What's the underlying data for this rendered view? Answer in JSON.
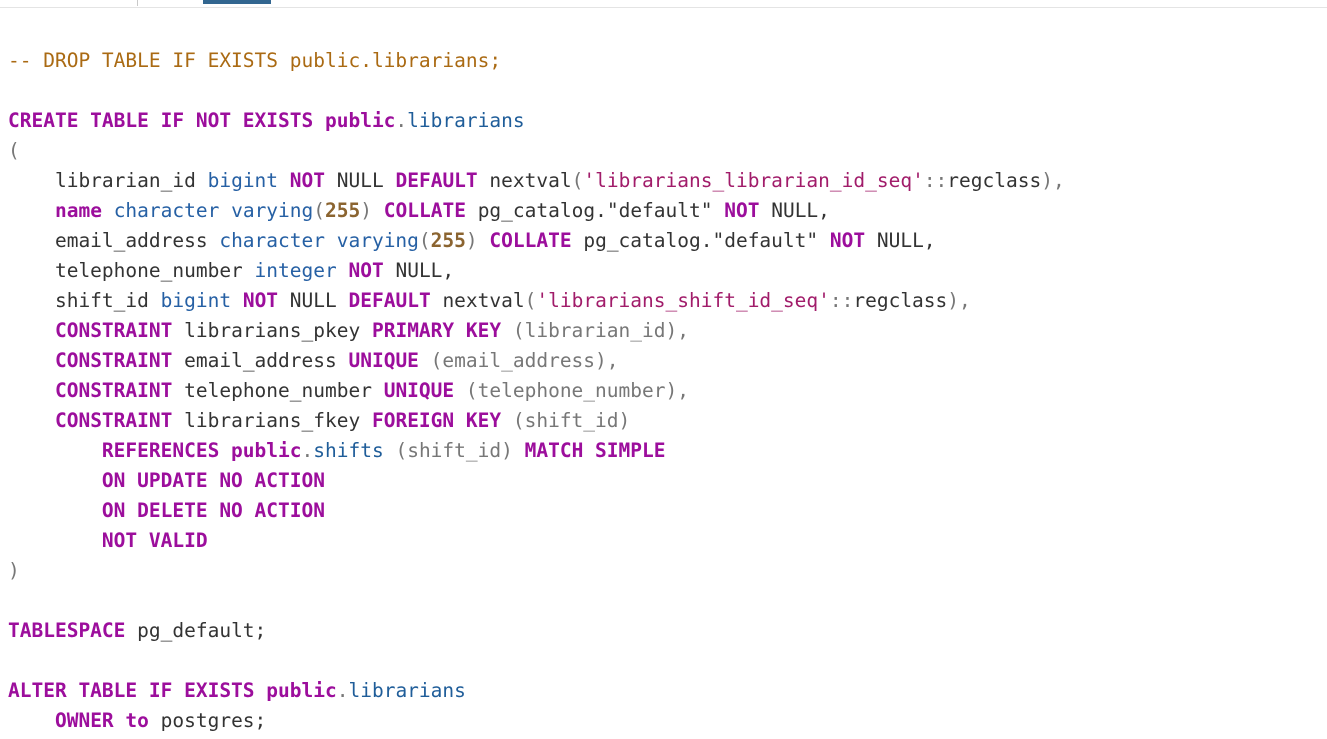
{
  "editor": {
    "lines": [
      [],
      [
        {
          "t": "-- DROP TABLE IF EXISTS public.librarians;",
          "c": "cmt"
        }
      ],
      [],
      [
        {
          "t": "CREATE TABLE IF NOT EXISTS public",
          "c": "kw"
        },
        {
          "t": ".",
          "c": "punc"
        },
        {
          "t": "librarians",
          "c": "ident"
        }
      ],
      [
        {
          "t": "(",
          "c": "punc"
        }
      ],
      [
        {
          "t": "    librarian_id ",
          "c": "plain"
        },
        {
          "t": "bigint",
          "c": "typ"
        },
        {
          "t": " ",
          "c": "plain"
        },
        {
          "t": "NOT",
          "c": "kw"
        },
        {
          "t": " NULL ",
          "c": "plain"
        },
        {
          "t": "DEFAULT",
          "c": "kw"
        },
        {
          "t": " nextval",
          "c": "plain"
        },
        {
          "t": "(",
          "c": "punc"
        },
        {
          "t": "'librarians_librarian_id_seq'",
          "c": "str"
        },
        {
          "t": "::",
          "c": "punc"
        },
        {
          "t": "regclass",
          "c": "plain"
        },
        {
          "t": "),",
          "c": "punc"
        }
      ],
      [
        {
          "t": "    ",
          "c": "plain"
        },
        {
          "t": "name",
          "c": "kw"
        },
        {
          "t": " ",
          "c": "plain"
        },
        {
          "t": "character varying",
          "c": "typ"
        },
        {
          "t": "(",
          "c": "punc"
        },
        {
          "t": "255",
          "c": "num"
        },
        {
          "t": ")",
          "c": "punc"
        },
        {
          "t": " ",
          "c": "plain"
        },
        {
          "t": "COLLATE",
          "c": "kw"
        },
        {
          "t": " pg_catalog.\"default\" ",
          "c": "plain"
        },
        {
          "t": "NOT",
          "c": "kw"
        },
        {
          "t": " NULL,",
          "c": "plain"
        }
      ],
      [
        {
          "t": "    email_address ",
          "c": "plain"
        },
        {
          "t": "character varying",
          "c": "typ"
        },
        {
          "t": "(",
          "c": "punc"
        },
        {
          "t": "255",
          "c": "num"
        },
        {
          "t": ")",
          "c": "punc"
        },
        {
          "t": " ",
          "c": "plain"
        },
        {
          "t": "COLLATE",
          "c": "kw"
        },
        {
          "t": " pg_catalog.\"default\" ",
          "c": "plain"
        },
        {
          "t": "NOT",
          "c": "kw"
        },
        {
          "t": " NULL,",
          "c": "plain"
        }
      ],
      [
        {
          "t": "    telephone_number ",
          "c": "plain"
        },
        {
          "t": "integer",
          "c": "typ"
        },
        {
          "t": " ",
          "c": "plain"
        },
        {
          "t": "NOT",
          "c": "kw"
        },
        {
          "t": " NULL,",
          "c": "plain"
        }
      ],
      [
        {
          "t": "    shift_id ",
          "c": "plain"
        },
        {
          "t": "bigint",
          "c": "typ"
        },
        {
          "t": " ",
          "c": "plain"
        },
        {
          "t": "NOT",
          "c": "kw"
        },
        {
          "t": " NULL ",
          "c": "plain"
        },
        {
          "t": "DEFAULT",
          "c": "kw"
        },
        {
          "t": " nextval",
          "c": "plain"
        },
        {
          "t": "(",
          "c": "punc"
        },
        {
          "t": "'librarians_shift_id_seq'",
          "c": "str"
        },
        {
          "t": "::",
          "c": "punc"
        },
        {
          "t": "regclass",
          "c": "plain"
        },
        {
          "t": "),",
          "c": "punc"
        }
      ],
      [
        {
          "t": "    ",
          "c": "plain"
        },
        {
          "t": "CONSTRAINT",
          "c": "kw"
        },
        {
          "t": " librarians_pkey ",
          "c": "plain"
        },
        {
          "t": "PRIMARY KEY",
          "c": "kw"
        },
        {
          "t": " (librarian_id),",
          "c": "punc"
        }
      ],
      [
        {
          "t": "    ",
          "c": "plain"
        },
        {
          "t": "CONSTRAINT",
          "c": "kw"
        },
        {
          "t": " email_address ",
          "c": "plain"
        },
        {
          "t": "UNIQUE",
          "c": "kw"
        },
        {
          "t": " (email_address),",
          "c": "punc"
        }
      ],
      [
        {
          "t": "    ",
          "c": "plain"
        },
        {
          "t": "CONSTRAINT",
          "c": "kw"
        },
        {
          "t": " telephone_number ",
          "c": "plain"
        },
        {
          "t": "UNIQUE",
          "c": "kw"
        },
        {
          "t": " (telephone_number),",
          "c": "punc"
        }
      ],
      [
        {
          "t": "    ",
          "c": "plain"
        },
        {
          "t": "CONSTRAINT",
          "c": "kw"
        },
        {
          "t": " librarians_fkey ",
          "c": "plain"
        },
        {
          "t": "FOREIGN KEY",
          "c": "kw"
        },
        {
          "t": " (shift_id)",
          "c": "punc"
        }
      ],
      [
        {
          "t": "        ",
          "c": "plain"
        },
        {
          "t": "REFERENCES public",
          "c": "kw"
        },
        {
          "t": ".",
          "c": "punc"
        },
        {
          "t": "shifts",
          "c": "ident"
        },
        {
          "t": " (shift_id) ",
          "c": "punc"
        },
        {
          "t": "MATCH SIMPLE",
          "c": "kw"
        }
      ],
      [
        {
          "t": "        ",
          "c": "plain"
        },
        {
          "t": "ON UPDATE NO ACTION",
          "c": "kw"
        }
      ],
      [
        {
          "t": "        ",
          "c": "plain"
        },
        {
          "t": "ON DELETE NO ACTION",
          "c": "kw"
        }
      ],
      [
        {
          "t": "        ",
          "c": "plain"
        },
        {
          "t": "NOT VALID",
          "c": "kw"
        }
      ],
      [
        {
          "t": ")",
          "c": "punc"
        }
      ],
      [],
      [
        {
          "t": "TABLESPACE",
          "c": "kw"
        },
        {
          "t": " pg_default;",
          "c": "plain"
        }
      ],
      [],
      [
        {
          "t": "ALTER TABLE IF EXISTS public",
          "c": "kw"
        },
        {
          "t": ".",
          "c": "punc"
        },
        {
          "t": "librarians",
          "c": "ident"
        }
      ],
      [
        {
          "t": "    ",
          "c": "plain"
        },
        {
          "t": "OWNER to",
          "c": "kw"
        },
        {
          "t": " postgres;",
          "c": "plain"
        }
      ]
    ]
  }
}
